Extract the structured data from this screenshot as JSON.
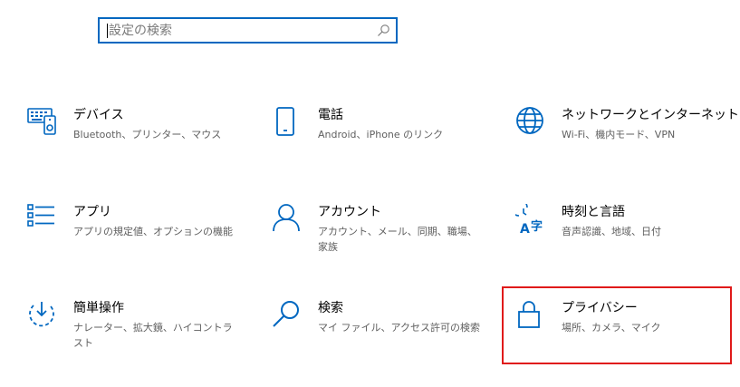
{
  "search": {
    "placeholder": "設定の検索"
  },
  "tiles": [
    {
      "title": "デバイス",
      "desc": "Bluetooth、プリンター、マウス",
      "icon": "keyboard-speaker-icon"
    },
    {
      "title": "電話",
      "desc": "Android、iPhone のリンク",
      "icon": "phone-icon"
    },
    {
      "title": "ネットワークとインターネット",
      "desc": "Wi-Fi、機内モード、VPN",
      "icon": "globe-icon"
    },
    {
      "title": "アプリ",
      "desc": "アプリの規定値、オプションの機能",
      "icon": "app-list-icon"
    },
    {
      "title": "アカウント",
      "desc": "アカウント、メール、同期、職場、家族",
      "icon": "person-icon"
    },
    {
      "title": "時刻と言語",
      "desc": "音声認識、地域、日付",
      "icon": "time-language-icon"
    },
    {
      "title": "簡単操作",
      "desc": "ナレーター、拡大鏡、ハイコントラスト",
      "icon": "ease-of-access-icon"
    },
    {
      "title": "検索",
      "desc": "マイ ファイル、アクセス許可の検索",
      "icon": "search-magnifier-icon"
    },
    {
      "title": "プライバシー",
      "desc": "場所、カメラ、マイク",
      "icon": "lock-icon"
    }
  ],
  "colors": {
    "accent": "#0067c0",
    "highlight": "#e01a1a"
  }
}
